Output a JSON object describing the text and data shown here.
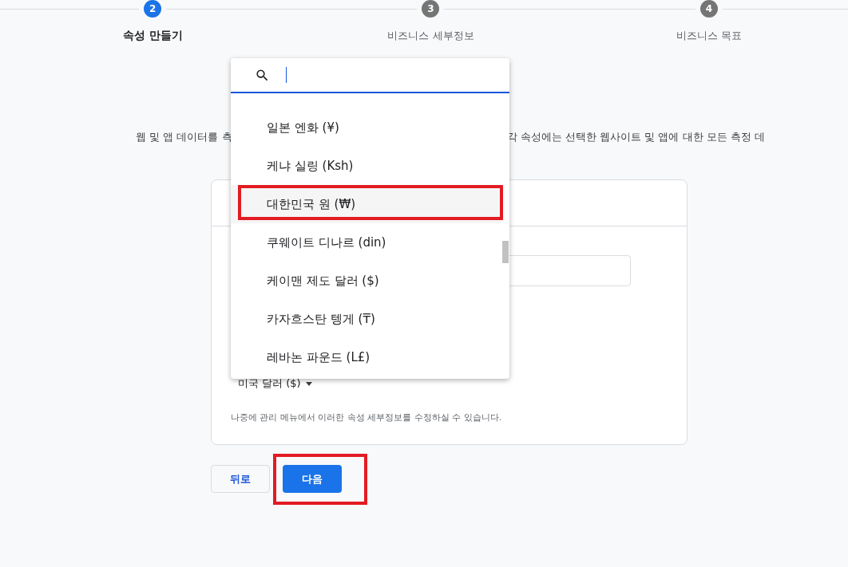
{
  "stepper": {
    "steps": [
      {
        "number": "2",
        "label": "속성 만들기",
        "selected": true
      },
      {
        "number": "3",
        "label": "비즈니스 세부정보",
        "selected": false
      },
      {
        "number": "4",
        "label": "비즈니스 목표",
        "selected": false
      }
    ]
  },
  "description": {
    "left": "웹 및 앱 데이터를 측",
    "right": "각 속성에는 선택한 웹사이트 및 앱에 대한 모든 측정 데"
  },
  "form": {
    "currency_select": "미국 달러 ($)",
    "help_text": "나중에 관리 메뉴에서 이러한 속성 세부정보를 수정하실 수 있습니다."
  },
  "currency_dropdown": {
    "items": [
      {
        "label": "일본 엔화 (¥)",
        "hovered": false,
        "annotated": false
      },
      {
        "label": "케냐 실링 (Ksh)",
        "hovered": false,
        "annotated": false
      },
      {
        "label": "대한민국 원 (₩)",
        "hovered": true,
        "annotated": true
      },
      {
        "label": "쿠웨이트 디나르 (din)",
        "hovered": false,
        "annotated": false
      },
      {
        "label": "케이맨 제도 달러 ($)",
        "hovered": false,
        "annotated": false
      },
      {
        "label": "카자흐스탄 텡게 (₸)",
        "hovered": false,
        "annotated": false
      },
      {
        "label": "레바논 파운드 (L£)",
        "hovered": false,
        "annotated": false
      }
    ]
  },
  "buttons": [
    {
      "label": "뒤로",
      "kind": "secondary",
      "annotated": false
    },
    {
      "label": "다음",
      "kind": "primary",
      "annotated": true
    }
  ]
}
